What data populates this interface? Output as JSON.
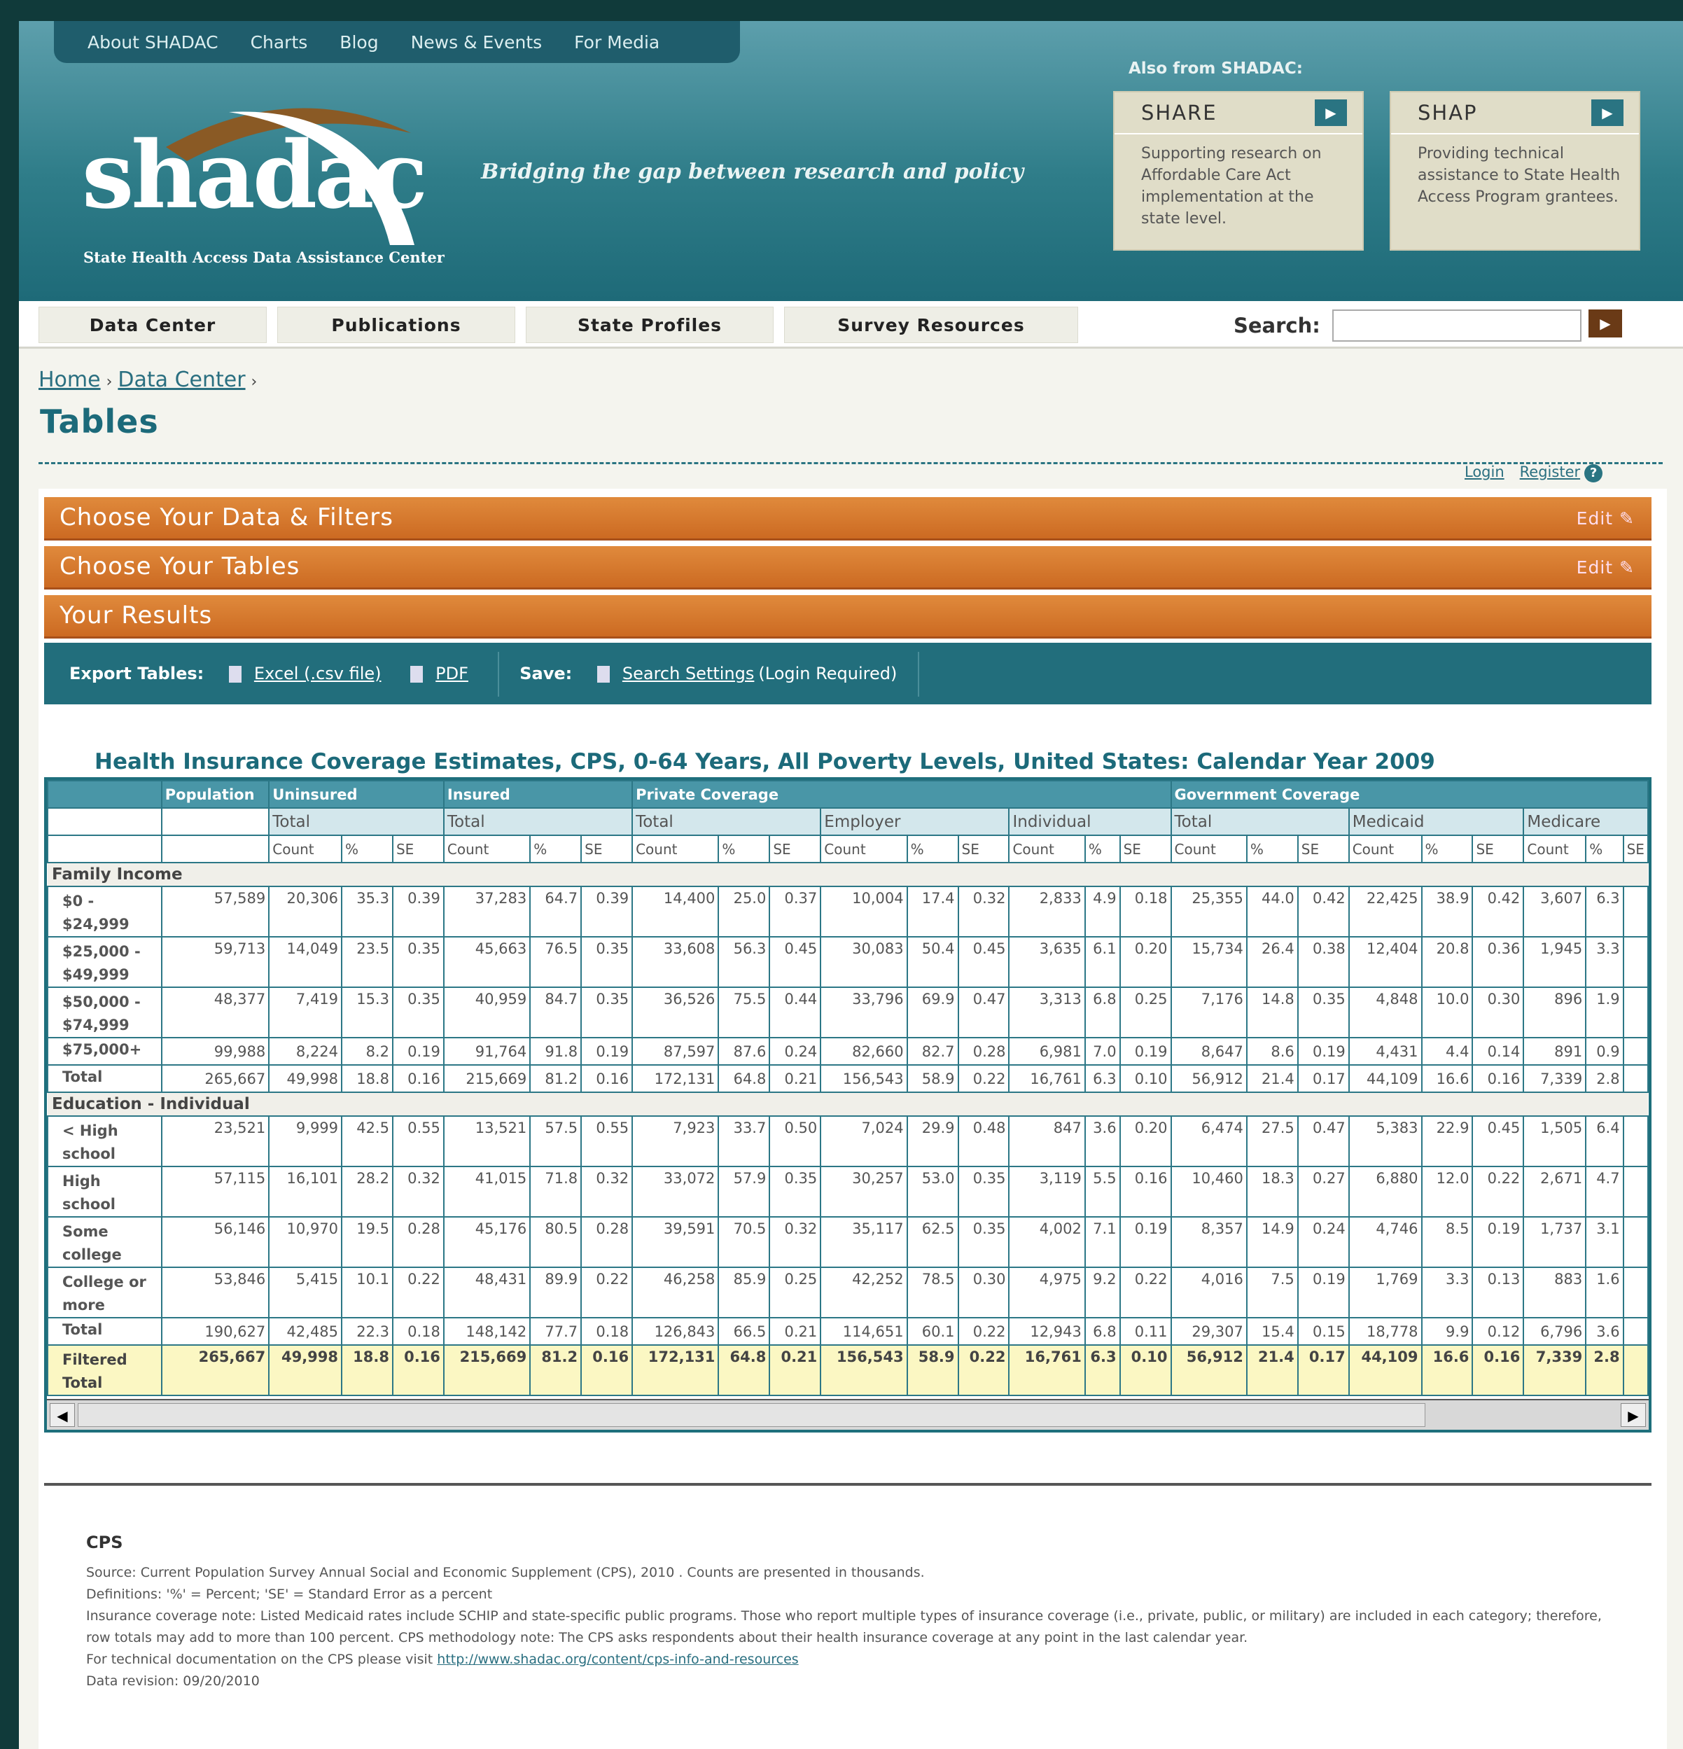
{
  "top_nav": [
    "About SHADAC",
    "Charts",
    "Blog",
    "News & Events",
    "For Media"
  ],
  "logo": {
    "word": "shadac",
    "subtitle": "State Health Access Data Assistance Center"
  },
  "tagline": "Bridging the gap between research and policy",
  "also_from": "Also from SHADAC:",
  "promos": [
    {
      "title": "SHARE",
      "text": "Supporting research on Affordable Care Act implementation at the state level."
    },
    {
      "title": "SHAP",
      "text": "Providing technical assistance to State Health Access Program grantees."
    }
  ],
  "main_nav": [
    "Data Center",
    "Publications",
    "State Profiles",
    "Survey Resources"
  ],
  "search": {
    "label": "Search:",
    "value": ""
  },
  "breadcrumb": [
    "Home",
    "Data Center"
  ],
  "page_title": "Tables",
  "account": {
    "login": "Login",
    "register": "Register"
  },
  "sections": {
    "filters": "Choose Your Data & Filters",
    "tables": "Choose Your Tables",
    "results": "Your Results",
    "edit_label": "Edit"
  },
  "export": {
    "label": "Export Tables:",
    "excel": "Excel (.csv file)",
    "pdf": "PDF",
    "save_label": "Save:",
    "settings": "Search Settings",
    "settings_note": "(Login Required)"
  },
  "table": {
    "title": "Health Insurance Coverage Estimates, CPS, 0-64 Years, All Poverty Levels, United States: Calendar Year 2009",
    "group_headers": [
      "Population",
      "Uninsured",
      "Insured",
      "Private Coverage",
      "Government Coverage"
    ],
    "sub_headers": [
      "Total",
      "Total",
      "Total",
      "Employer",
      "Individual",
      "Total",
      "Medicaid",
      "Medicare"
    ],
    "col_headers": [
      "Count",
      "%",
      "SE"
    ],
    "sections": [
      {
        "name": "Family Income",
        "rows": [
          {
            "label": "$0 - $24,999",
            "values": [
              "57,589",
              "20,306",
              "35.3",
              "0.39",
              "37,283",
              "64.7",
              "0.39",
              "14,400",
              "25.0",
              "0.37",
              "10,004",
              "17.4",
              "0.32",
              "2,833",
              "4.9",
              "0.18",
              "25,355",
              "44.0",
              "0.42",
              "22,425",
              "38.9",
              "0.42",
              "3,607",
              "6.3"
            ]
          },
          {
            "label": "$25,000 - $49,999",
            "values": [
              "59,713",
              "14,049",
              "23.5",
              "0.35",
              "45,663",
              "76.5",
              "0.35",
              "33,608",
              "56.3",
              "0.45",
              "30,083",
              "50.4",
              "0.45",
              "3,635",
              "6.1",
              "0.20",
              "15,734",
              "26.4",
              "0.38",
              "12,404",
              "20.8",
              "0.36",
              "1,945",
              "3.3"
            ]
          },
          {
            "label": "$50,000 - $74,999",
            "values": [
              "48,377",
              "7,419",
              "15.3",
              "0.35",
              "40,959",
              "84.7",
              "0.35",
              "36,526",
              "75.5",
              "0.44",
              "33,796",
              "69.9",
              "0.47",
              "3,313",
              "6.8",
              "0.25",
              "7,176",
              "14.8",
              "0.35",
              "4,848",
              "10.0",
              "0.30",
              "896",
              "1.9"
            ]
          },
          {
            "label": "$75,000+",
            "values": [
              "99,988",
              "8,224",
              "8.2",
              "0.19",
              "91,764",
              "91.8",
              "0.19",
              "87,597",
              "87.6",
              "0.24",
              "82,660",
              "82.7",
              "0.28",
              "6,981",
              "7.0",
              "0.19",
              "8,647",
              "8.6",
              "0.19",
              "4,431",
              "4.4",
              "0.14",
              "891",
              "0.9"
            ]
          },
          {
            "label": "Total",
            "values": [
              "265,667",
              "49,998",
              "18.8",
              "0.16",
              "215,669",
              "81.2",
              "0.16",
              "172,131",
              "64.8",
              "0.21",
              "156,543",
              "58.9",
              "0.22",
              "16,761",
              "6.3",
              "0.10",
              "56,912",
              "21.4",
              "0.17",
              "44,109",
              "16.6",
              "0.16",
              "7,339",
              "2.8"
            ]
          }
        ]
      },
      {
        "name": "Education - Individual",
        "rows": [
          {
            "label": "< High school",
            "values": [
              "23,521",
              "9,999",
              "42.5",
              "0.55",
              "13,521",
              "57.5",
              "0.55",
              "7,923",
              "33.7",
              "0.50",
              "7,024",
              "29.9",
              "0.48",
              "847",
              "3.6",
              "0.20",
              "6,474",
              "27.5",
              "0.47",
              "5,383",
              "22.9",
              "0.45",
              "1,505",
              "6.4"
            ]
          },
          {
            "label": "High school",
            "values": [
              "57,115",
              "16,101",
              "28.2",
              "0.32",
              "41,015",
              "71.8",
              "0.32",
              "33,072",
              "57.9",
              "0.35",
              "30,257",
              "53.0",
              "0.35",
              "3,119",
              "5.5",
              "0.16",
              "10,460",
              "18.3",
              "0.27",
              "6,880",
              "12.0",
              "0.22",
              "2,671",
              "4.7"
            ]
          },
          {
            "label": "Some college",
            "values": [
              "56,146",
              "10,970",
              "19.5",
              "0.28",
              "45,176",
              "80.5",
              "0.28",
              "39,591",
              "70.5",
              "0.32",
              "35,117",
              "62.5",
              "0.35",
              "4,002",
              "7.1",
              "0.19",
              "8,357",
              "14.9",
              "0.24",
              "4,746",
              "8.5",
              "0.19",
              "1,737",
              "3.1"
            ]
          },
          {
            "label": "College or more",
            "values": [
              "53,846",
              "5,415",
              "10.1",
              "0.22",
              "48,431",
              "89.9",
              "0.22",
              "46,258",
              "85.9",
              "0.25",
              "42,252",
              "78.5",
              "0.30",
              "4,975",
              "9.2",
              "0.22",
              "4,016",
              "7.5",
              "0.19",
              "1,769",
              "3.3",
              "0.13",
              "883",
              "1.6"
            ]
          },
          {
            "label": "Total",
            "values": [
              "190,627",
              "42,485",
              "22.3",
              "0.18",
              "148,142",
              "77.7",
              "0.18",
              "126,843",
              "66.5",
              "0.21",
              "114,651",
              "60.1",
              "0.22",
              "12,943",
              "6.8",
              "0.11",
              "29,307",
              "15.4",
              "0.15",
              "18,778",
              "9.9",
              "0.12",
              "6,796",
              "3.6"
            ]
          }
        ]
      }
    ],
    "filtered_total": {
      "label": "Filtered Total",
      "values": [
        "265,667",
        "49,998",
        "18.8",
        "0.16",
        "215,669",
        "81.2",
        "0.16",
        "172,131",
        "64.8",
        "0.21",
        "156,543",
        "58.9",
        "0.22",
        "16,761",
        "6.3",
        "0.10",
        "56,912",
        "21.4",
        "0.17",
        "44,109",
        "16.6",
        "0.16",
        "7,339",
        "2.8"
      ]
    }
  },
  "notes": {
    "heading": "CPS",
    "lines": [
      "Source: Current Population Survey Annual Social and Economic Supplement (CPS), 2010 . Counts are presented in thousands.",
      "Definitions: '%' = Percent; 'SE' = Standard Error as a percent",
      "Insurance coverage note: Listed Medicaid rates include SCHIP and state-specific public programs. Those who report multiple types of insurance coverage (i.e., private, public, or military) are included in each category; therefore, row totals may add to more than 100 percent. CPS methodology note: The CPS asks respondents about their health insurance coverage at any point in the last calendar year."
    ],
    "doc_prefix": "For technical documentation on the CPS please visit",
    "doc_link": "http://www.shadac.org/content/cps-info-and-resources",
    "revision": "Data revision: 09/20/2010"
  }
}
